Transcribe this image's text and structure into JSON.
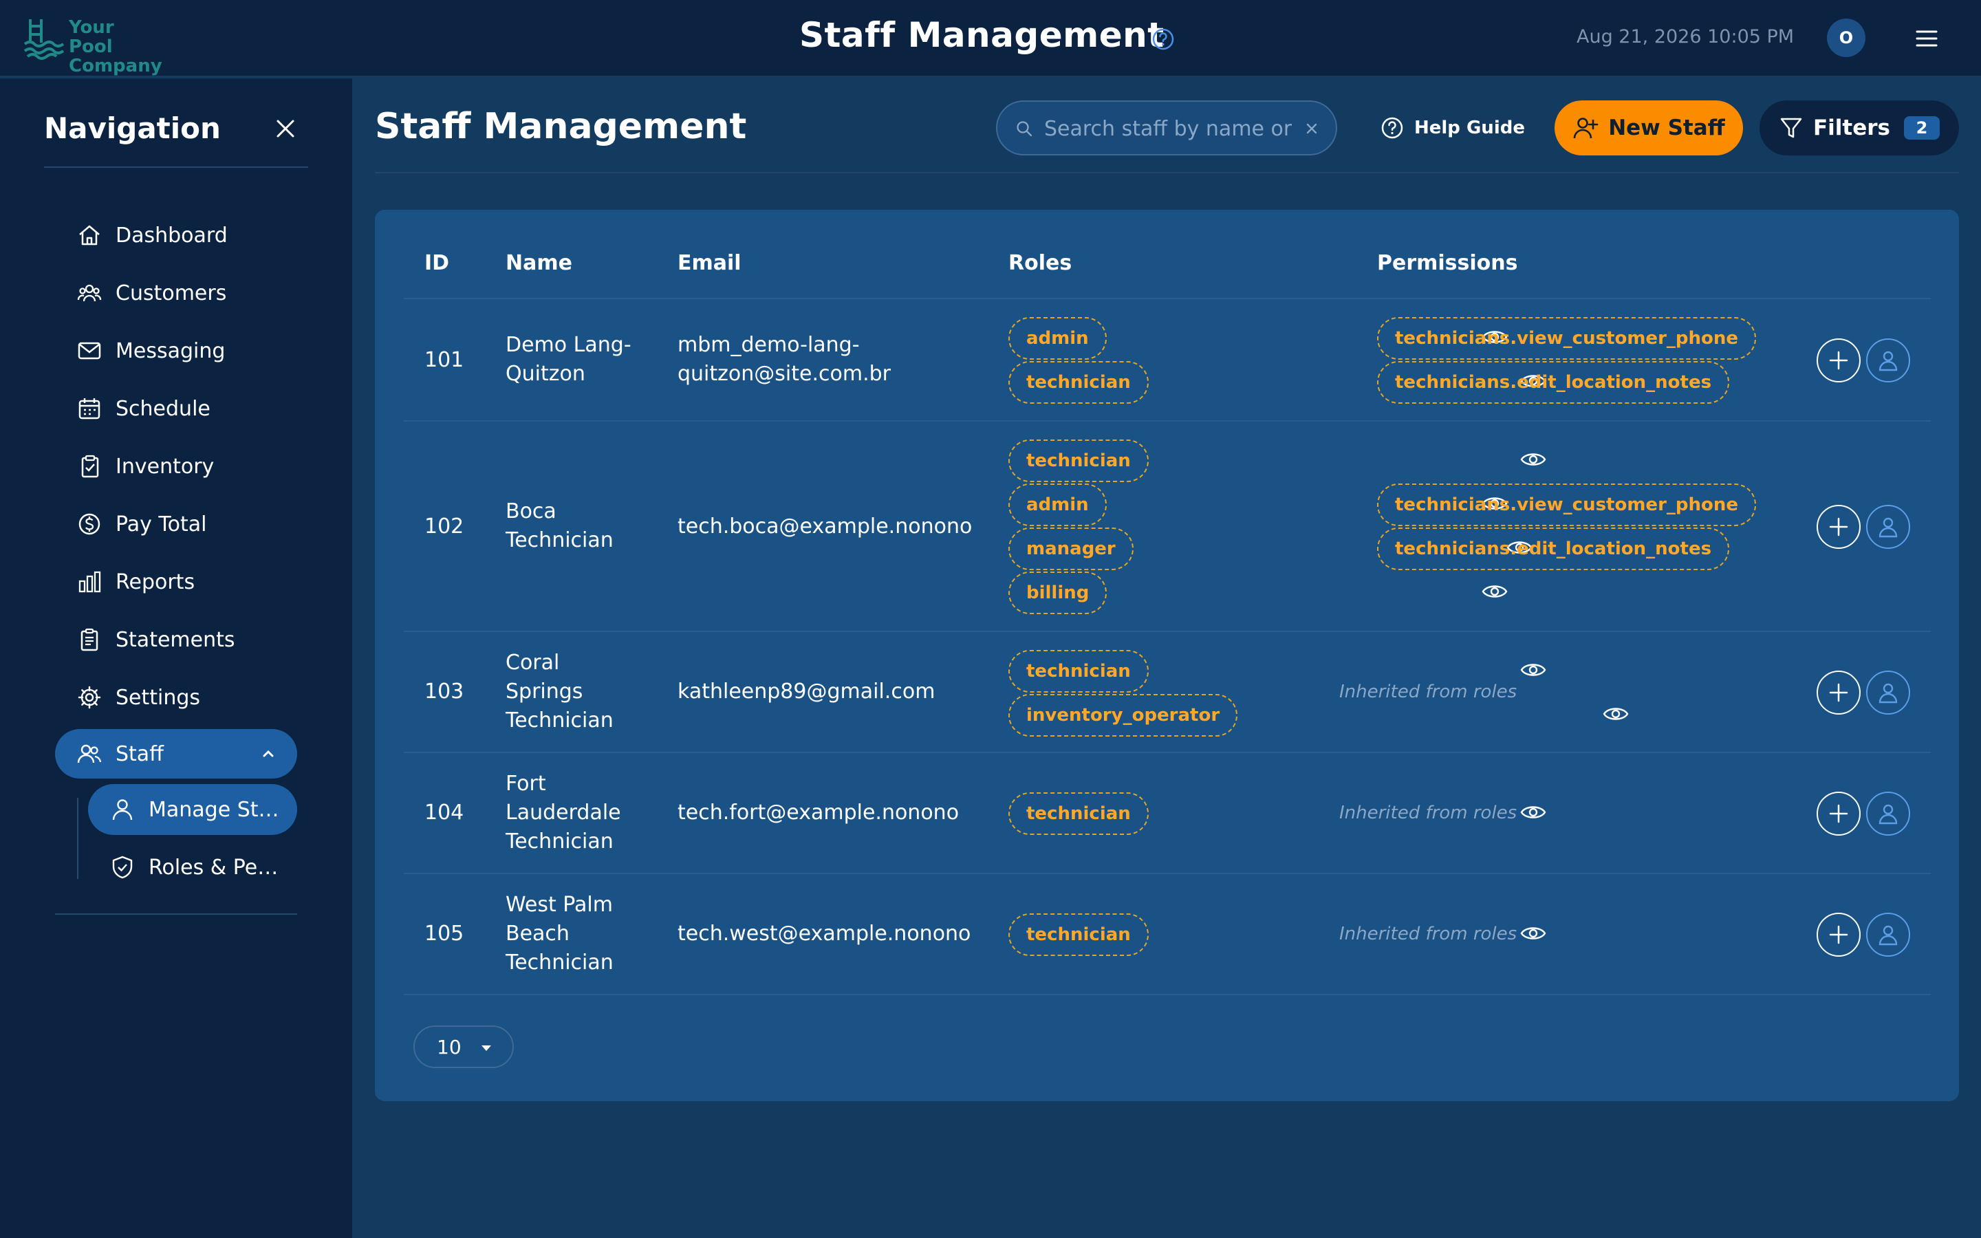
{
  "header": {
    "logo_line1": "Your Pool",
    "logo_line2": "Company",
    "title": "Staff Management",
    "datetime": "Aug 21, 2026 10:05 PM",
    "avatar_initial": "O"
  },
  "sidebar": {
    "title": "Navigation",
    "items": [
      {
        "label": "Dashboard",
        "icon": "home-icon"
      },
      {
        "label": "Customers",
        "icon": "users-icon"
      },
      {
        "label": "Messaging",
        "icon": "mail-icon"
      },
      {
        "label": "Schedule",
        "icon": "calendar-icon"
      },
      {
        "label": "Inventory",
        "icon": "clipboard-check-icon"
      },
      {
        "label": "Pay Total",
        "icon": "dollar-circle-icon"
      },
      {
        "label": "Reports",
        "icon": "bar-chart-icon"
      },
      {
        "label": "Statements",
        "icon": "document-icon"
      },
      {
        "label": "Settings",
        "icon": "gear-icon"
      },
      {
        "label": "Staff",
        "icon": "users-icon",
        "active": true,
        "expanded": true
      }
    ],
    "sub_items": [
      {
        "label": "Manage Staff",
        "icon": "user-icon",
        "active": true
      },
      {
        "label": "Roles & Permissions",
        "icon": "shield-check-icon"
      }
    ]
  },
  "main": {
    "page_title": "Staff Management",
    "search_placeholder": "Search staff by name or email",
    "help_label": "Help Guide",
    "new_staff_label": "New Staff",
    "filters_label": "Filters",
    "filters_count": "2",
    "per_page": "10"
  },
  "table": {
    "columns": [
      "ID",
      "Name",
      "Email",
      "Roles",
      "Permissions"
    ],
    "inherited_text": "Inherited from roles",
    "rows": [
      {
        "id": "101",
        "name": "Demo Lang-Quitzon",
        "email": "mbm_demo-lang-quitzon@site.com.br",
        "roles": [
          "admin",
          "technician"
        ],
        "permissions": [
          "technicians.view_customer_phone",
          "technicians.edit_location_notes"
        ]
      },
      {
        "id": "102",
        "name": "Boca Technician",
        "email": "tech.boca@example.nonono",
        "roles": [
          "technician",
          "admin",
          "manager",
          "billing"
        ],
        "permissions": [
          "technicians.view_customer_phone",
          "technicians.edit_location_notes"
        ]
      },
      {
        "id": "103",
        "name": "Coral Springs Technician",
        "email": "kathleenp89@gmail.com",
        "roles": [
          "technician",
          "inventory_operator"
        ],
        "permissions": []
      },
      {
        "id": "104",
        "name": "Fort Lauderdale Technician",
        "email": "tech.fort@example.nonono",
        "roles": [
          "technician"
        ],
        "permissions": []
      },
      {
        "id": "105",
        "name": "West Palm Beach Technician",
        "email": "tech.west@example.nonono",
        "roles": [
          "technician"
        ],
        "permissions": []
      }
    ]
  },
  "colors": {
    "page_bg": "#133a5f",
    "sidebar_bg": "#0b2340",
    "card_bg": "#1a5285",
    "accent": "#fb8c00",
    "chip_text": "#ffa726",
    "active_nav": "#1e5fa4"
  }
}
